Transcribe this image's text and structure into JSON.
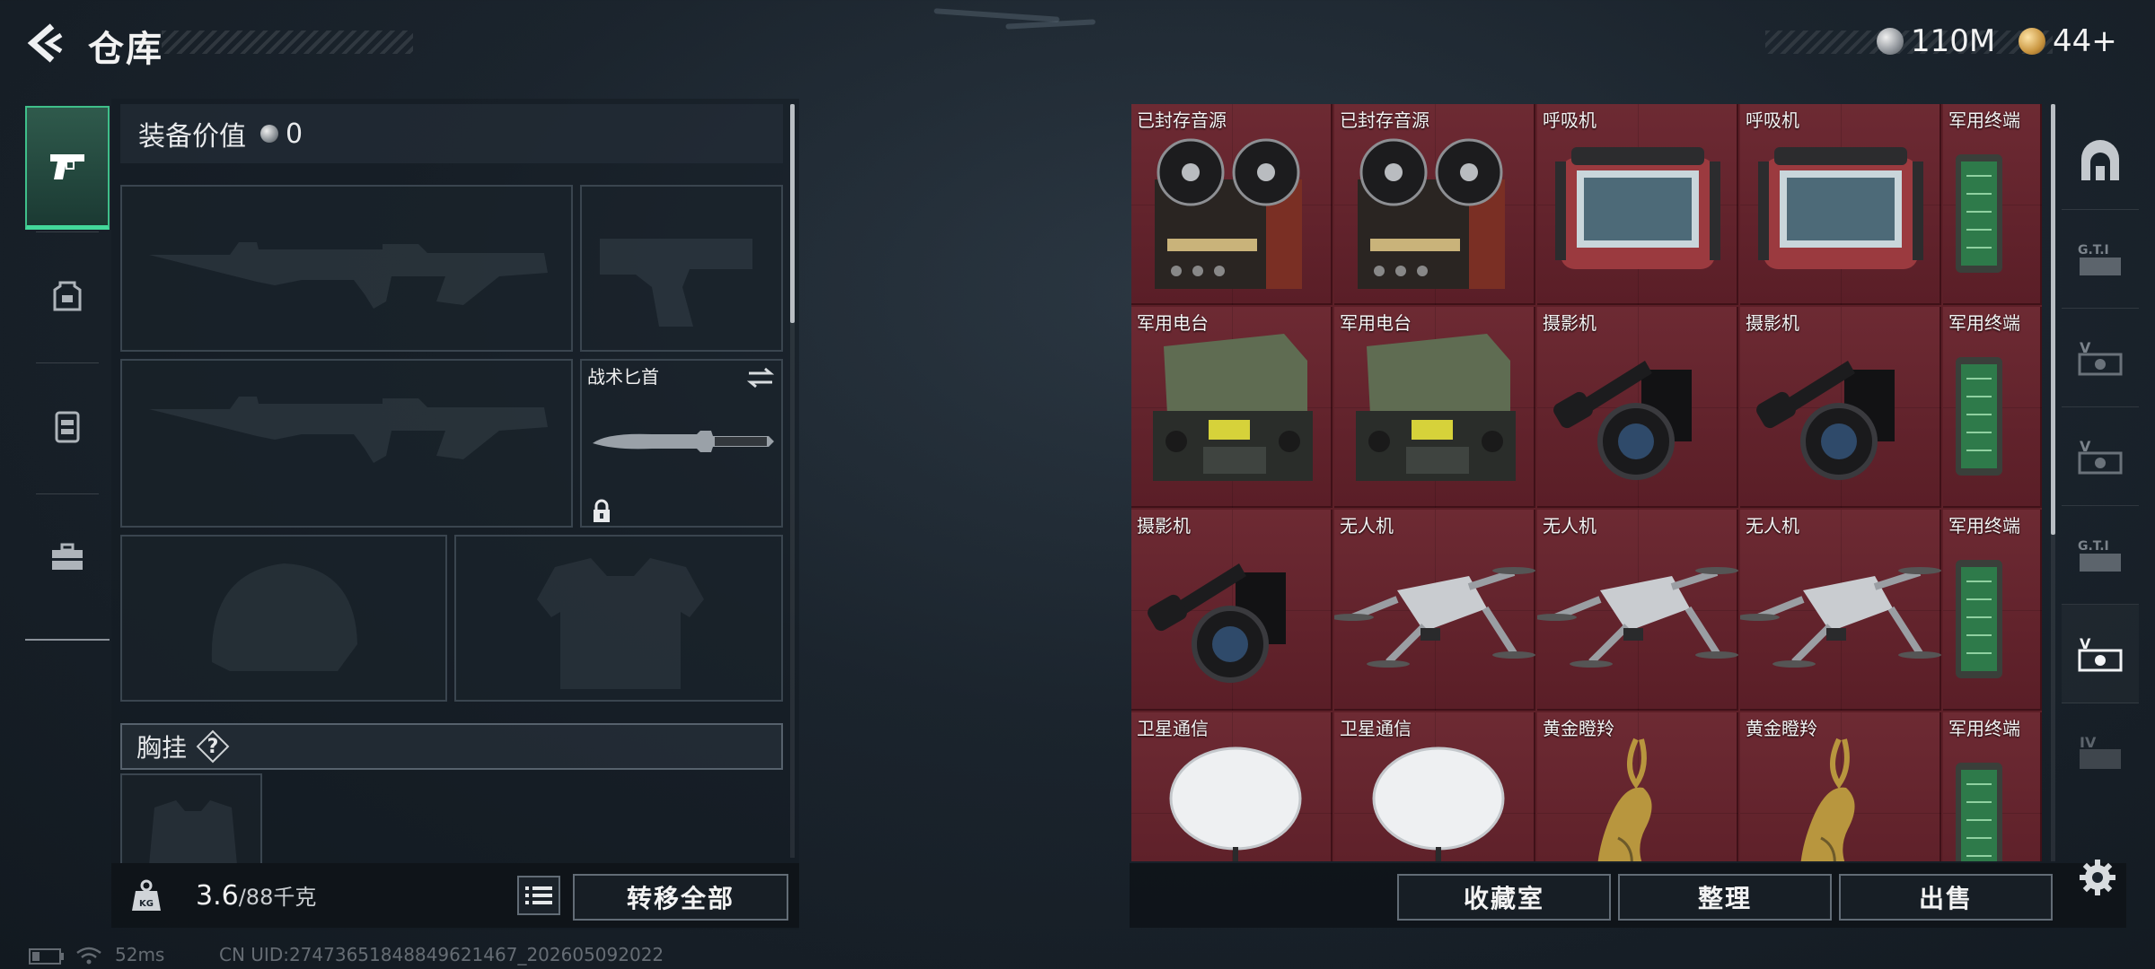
{
  "header": {
    "title": "仓库",
    "currencies": [
      {
        "icon": "silver-coin-icon",
        "value": "110M"
      },
      {
        "icon": "gold-coin-icon",
        "value": "44+"
      }
    ]
  },
  "left_rail": {
    "items": [
      {
        "icon": "pistol-icon",
        "active": true
      },
      {
        "icon": "backpack-icon",
        "active": false
      },
      {
        "icon": "chest-rig-icon",
        "active": false
      },
      {
        "icon": "toolbox-icon",
        "active": false
      }
    ]
  },
  "equipment": {
    "value_label": "装备价值",
    "value": "0",
    "melee_slot_label": "战术匕首",
    "chest_rig_label": "胸挂",
    "help_symbol": "?",
    "weight_current": "3.6",
    "weight_max": "/88千克",
    "kg_label": "KG",
    "transfer_all_label": "转移全部"
  },
  "storage": {
    "items": [
      "已封存音源",
      "已封存音源",
      "呼吸机",
      "呼吸机",
      "军用终端",
      "军用电台",
      "军用电台",
      "摄影机",
      "摄影机",
      "军用终端",
      "摄影机",
      "无人机",
      "无人机",
      "无人机",
      "军用终端",
      "卫星通信",
      "卫星通信",
      "黄金瞪羚",
      "黄金瞪羚",
      "军用终端"
    ],
    "buttons": {
      "collection": "收藏室",
      "sort": "整理",
      "sell": "出售"
    }
  },
  "right_tabs": [
    {
      "icon": "vault-door-icon"
    },
    {
      "icon": "gti-storage-icon"
    },
    {
      "icon": "v-crate-icon"
    },
    {
      "icon": "v-crate-icon"
    },
    {
      "icon": "gti-storage-icon"
    },
    {
      "icon": "v-crate-icon",
      "active": true
    },
    {
      "icon": "iv-crate-icon"
    }
  ],
  "status": {
    "ping": "52ms",
    "uid": "CN UID:27473651848849621467_202605092022"
  },
  "colors": {
    "accent_green": "#43d89b",
    "item_red_bg": "#6d2a33"
  }
}
